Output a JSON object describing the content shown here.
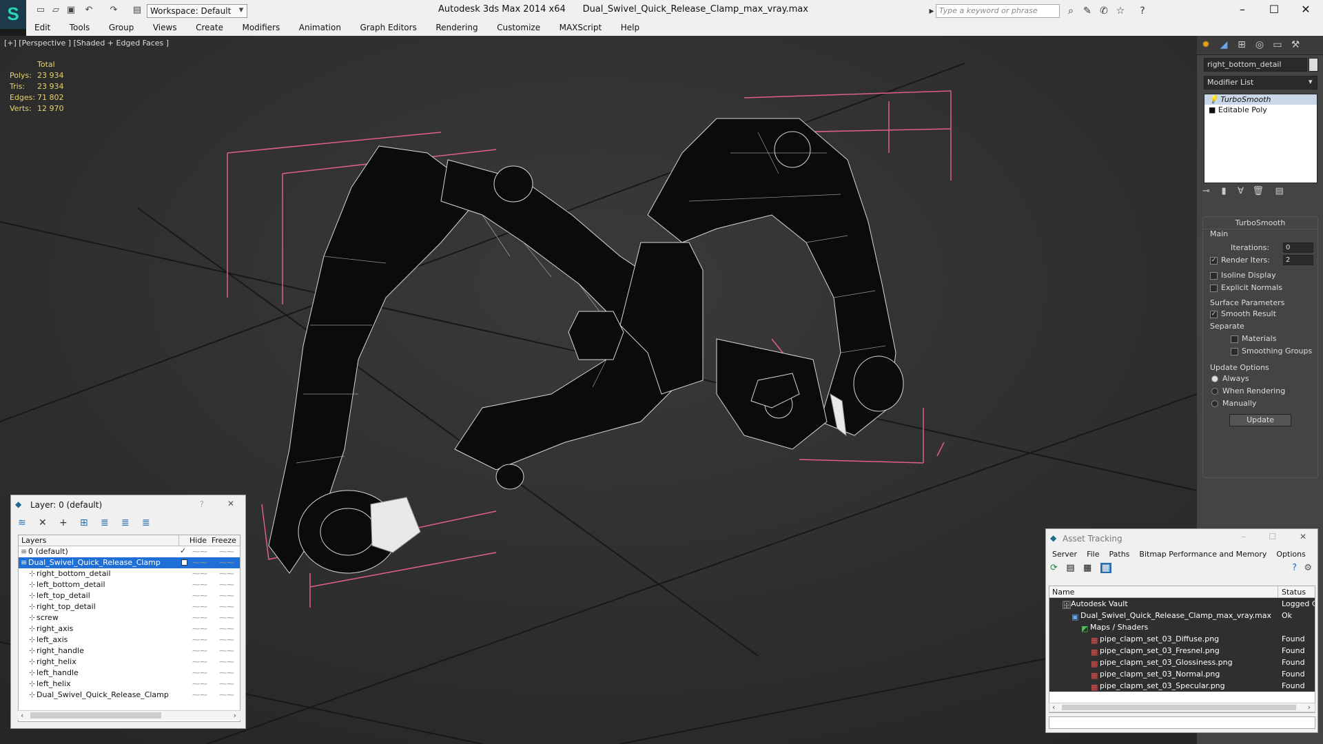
{
  "app": {
    "title": "Autodesk 3ds Max  2014 x64",
    "file": "Dual_Swivel_Quick_Release_Clamp_max_vray.max",
    "workspace": "Workspace: Default",
    "search_placeholder": "Type a keyword or phrase",
    "logo_letter": "S"
  },
  "menu": [
    "Edit",
    "Tools",
    "Group",
    "Views",
    "Create",
    "Modifiers",
    "Animation",
    "Graph Editors",
    "Rendering",
    "Customize",
    "MAXScript",
    "Help"
  ],
  "viewport": {
    "label": "[+] [Perspective ] [Shaded + Edged Faces ]",
    "stats": {
      "header": "Total",
      "rows": [
        {
          "k": "Polys:",
          "v": "23 934"
        },
        {
          "k": "Tris:",
          "v": "23 934"
        },
        {
          "k": "Edges:",
          "v": "71 802"
        },
        {
          "k": "Verts:",
          "v": "12 970"
        }
      ]
    }
  },
  "command_panel": {
    "object_name": "right_bottom_detail",
    "modifier_list": "Modifier List",
    "stack": [
      "TurboSmooth",
      "Editable Poly"
    ],
    "rollout_title": "TurboSmooth",
    "main_label": "Main",
    "iterations_label": "Iterations:",
    "iterations_value": "0",
    "render_iters_label": "Render Iters:",
    "render_iters_value": "2",
    "isoline": "Isoline Display",
    "explicit": "Explicit Normals",
    "surface_params": "Surface Parameters",
    "smooth_result": "Smooth Result",
    "separate": "Separate",
    "materials": "Materials",
    "smoothing_groups": "Smoothing Groups",
    "update_options": "Update Options",
    "always": "Always",
    "when_rendering": "When Rendering",
    "manually": "Manually",
    "update_button": "Update"
  },
  "layer_window": {
    "title": "Layer: 0 (default)",
    "col_layers": "Layers",
    "col_hide": "Hide",
    "col_freeze": "Freeze",
    "rows": [
      {
        "name": "0 (default)",
        "indent": 1,
        "selected": false
      },
      {
        "name": "Dual_Swivel_Quick_Release_Clamp",
        "indent": 1,
        "selected": true
      },
      {
        "name": "right_bottom_detail",
        "indent": 2,
        "selected": false
      },
      {
        "name": "left_bottom_detail",
        "indent": 2,
        "selected": false
      },
      {
        "name": "left_top_detail",
        "indent": 2,
        "selected": false
      },
      {
        "name": "right_top_detail",
        "indent": 2,
        "selected": false
      },
      {
        "name": "screw",
        "indent": 2,
        "selected": false
      },
      {
        "name": "right_axis",
        "indent": 2,
        "selected": false
      },
      {
        "name": "left_axis",
        "indent": 2,
        "selected": false
      },
      {
        "name": "right_handle",
        "indent": 2,
        "selected": false
      },
      {
        "name": "right_helix",
        "indent": 2,
        "selected": false
      },
      {
        "name": "left_handle",
        "indent": 2,
        "selected": false
      },
      {
        "name": "left_helix",
        "indent": 2,
        "selected": false
      },
      {
        "name": "Dual_Swivel_Quick_Release_Clamp",
        "indent": 2,
        "selected": false
      }
    ]
  },
  "asset_window": {
    "title": "Asset Tracking",
    "menu": [
      "Server",
      "File",
      "Paths",
      "Bitmap Performance and Memory",
      "Options"
    ],
    "col_name": "Name",
    "col_status": "Status",
    "rows": [
      {
        "name": "Autodesk Vault",
        "status": "Logged C",
        "indent": 1
      },
      {
        "name": "Dual_Swivel_Quick_Release_Clamp_max_vray.max",
        "status": "Ok",
        "indent": 2
      },
      {
        "name": "Maps / Shaders",
        "status": "",
        "indent": 3
      },
      {
        "name": "pipe_clapm_set_03_Diffuse.png",
        "status": "Found",
        "indent": 4
      },
      {
        "name": "pipe_clapm_set_03_Fresnel.png",
        "status": "Found",
        "indent": 4
      },
      {
        "name": "pipe_clapm_set_03_Glossiness.png",
        "status": "Found",
        "indent": 4
      },
      {
        "name": "pipe_clapm_set_03_Normal.png",
        "status": "Found",
        "indent": 4
      },
      {
        "name": "pipe_clapm_set_03_Specular.png",
        "status": "Found",
        "indent": 4
      }
    ]
  },
  "colors": {
    "selection": "#1e6fd6",
    "stats": "#e9d36a",
    "bbox": "#e0608a",
    "accent": "#2ad3c0"
  }
}
